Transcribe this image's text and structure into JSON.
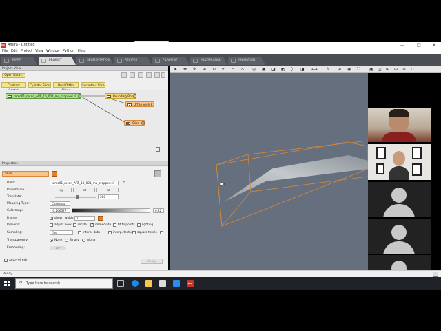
{
  "zoom_bar": {
    "dots": "•••• ••••"
  },
  "window": {
    "app_icon": "Am",
    "title": "Amira - Untitled",
    "minimize": "—",
    "maximize": "□",
    "close": "✕"
  },
  "menu": [
    "File",
    "Edit",
    "Project",
    "View",
    "Window",
    "Python",
    "Help"
  ],
  "tabs": [
    {
      "label": "START",
      "active": false
    },
    {
      "label": "PROJECT",
      "active": true
    },
    {
      "label": "SEGMENTATION",
      "active": false
    },
    {
      "label": "RECIPES",
      "active": false
    },
    {
      "label": "FILAMENT",
      "active": false
    },
    {
      "label": "MULTIPLANAR",
      "active": false
    },
    {
      "label": "ANIMATION",
      "active": false
    }
  ],
  "project_view": {
    "header": "Project View",
    "open_data": "Open Data...",
    "quick_modules": [
      "Contrast Control",
      "Cylinder Slice",
      "Dual Ortho Slices",
      "Isocontour Slice"
    ],
    "nodes": {
      "data": "tomo01_recon_ART_10_001_mu_cropped.tif",
      "bounding_box": "Bounding Box",
      "ortho_slice": "Ortho Slice",
      "slice": "Slice"
    }
  },
  "properties": {
    "header": "Properties",
    "module_name": "Slice",
    "data_label": "Data:",
    "data_value": "tomo01_recon_ART_10_001_mu_cropped.tif",
    "orientation_label": "Orientation:",
    "orientation_buttons": [
      "xy",
      "xz",
      "yz"
    ],
    "translate_label": "Translate:",
    "translate_value": "200",
    "mapping_type_label": "Mapping Type:",
    "mapping_type_value": "Colormap",
    "colormap_label": "Colormap:",
    "colormap_min": "-0.266377",
    "colormap_max": "0.22",
    "frame_label": "Frame:",
    "frame_show": "show",
    "frame_width_label": "width:",
    "frame_width_value": "1",
    "options_label": "Options:",
    "options": [
      "adjust view",
      "rotate",
      "immediate",
      "fit to points",
      "lighting"
    ],
    "sampling_label": "Sampling:",
    "sampling_value": "fine",
    "sampling_options": [
      "interp. data",
      "interp. texture",
      "square texels"
    ],
    "transparency_label": "Transparency:",
    "transparency_options": [
      "None",
      "Binary",
      "Alpha"
    ],
    "embossing_label": "Embossing:",
    "embossing_value": "OFF",
    "auto_refresh": "auto-refresh",
    "apply": "Apply"
  },
  "status": {
    "text": "Ready"
  },
  "taskbar": {
    "search_placeholder": "Type here to search",
    "amira_icon": "Am"
  }
}
